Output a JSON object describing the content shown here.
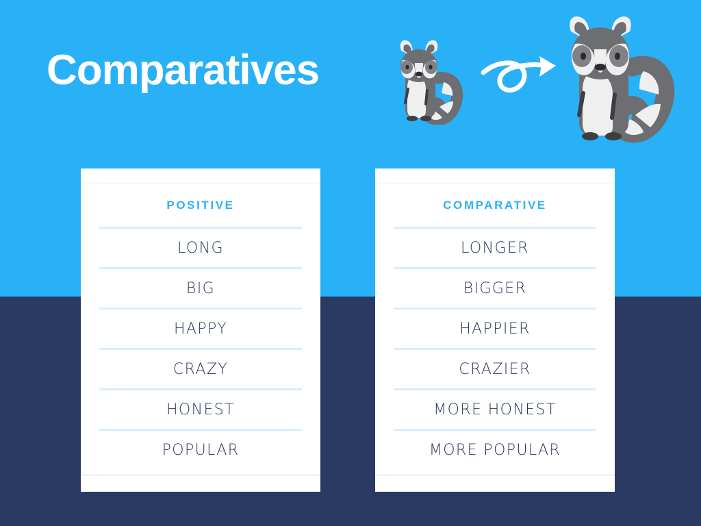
{
  "slide": {
    "title": "Comparatives",
    "background_top_color": "#29b1f7",
    "background_bottom_color": "#2a3a63",
    "accent_color": "#2eb2f7",
    "text_color": "#2b3a5e",
    "divider_color": "#d9eeff"
  },
  "illustrations": {
    "small_raccoon": "raccoon-small-icon",
    "arrow": "curly-arrow-right-icon",
    "large_raccoon": "raccoon-large-icon"
  },
  "tables": [
    {
      "header": "POSITIVE",
      "rows": [
        "LONG",
        "BIG",
        "HAPPY",
        "CRAZY",
        "HONEST",
        "POPULAR"
      ]
    },
    {
      "header": "COMPARATIVE",
      "rows": [
        "LONGER",
        "BIGGER",
        "HAPPIER",
        "CRAZIER",
        "MORE HONEST",
        "MORE POPULAR"
      ]
    }
  ]
}
